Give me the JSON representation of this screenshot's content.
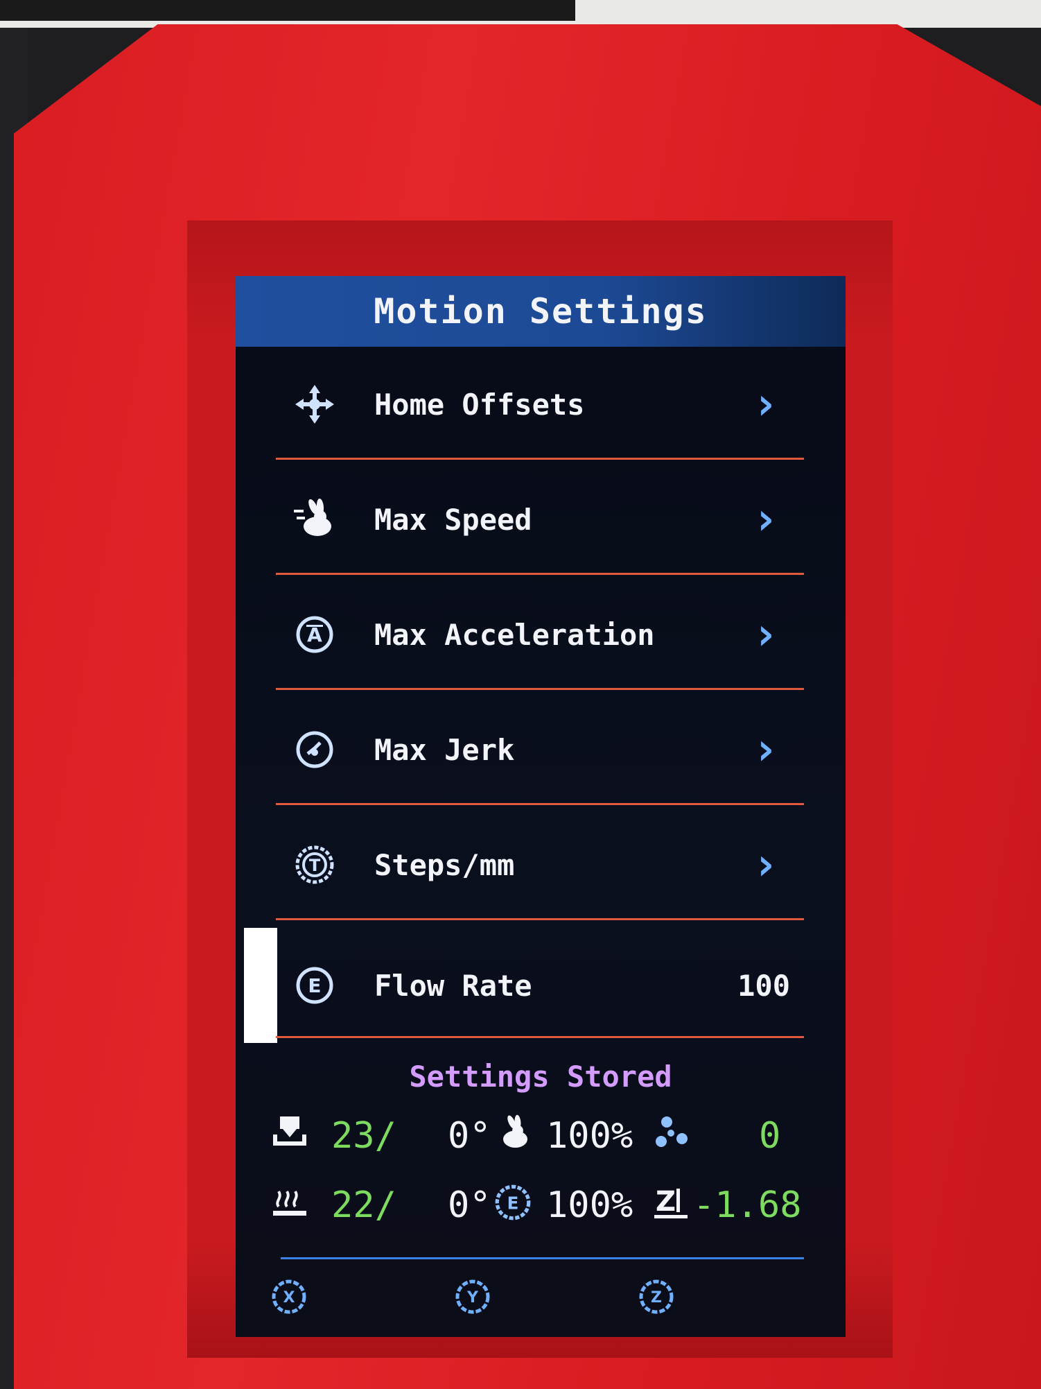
{
  "header": {
    "title": "Motion Settings"
  },
  "menu": [
    {
      "label": "Home Offsets",
      "icon": "move-arrows-icon",
      "has_submenu": true
    },
    {
      "label": "Max Speed",
      "icon": "rabbit-speed-icon",
      "has_submenu": true
    },
    {
      "label": "Max Acceleration",
      "icon": "acceleration-icon",
      "has_submenu": true
    },
    {
      "label": "Max Jerk",
      "icon": "jerk-gauge-icon",
      "has_submenu": true
    },
    {
      "label": "Steps/mm",
      "icon": "stepper-icon",
      "has_submenu": true
    },
    {
      "label": "Flow Rate",
      "icon": "extruder-e-icon",
      "value": "100",
      "selected": true
    }
  ],
  "status_message": "Settings Stored",
  "status": {
    "hotend_temp": "23",
    "hotend_target": "0°",
    "bed_temp": "22",
    "bed_target": "0°",
    "feedrate": "100%",
    "flowrate": "100%",
    "fan_speed": "0",
    "z_offset": "-1.68",
    "temp_unit_glyph": "/"
  },
  "axes": [
    "X",
    "Y",
    "Z"
  ],
  "colors": {
    "title_bar": "#1f4f9e",
    "separator": "#e0593c",
    "accent_blue": "#6fb0ff",
    "status_green": "#7ddc5f",
    "message_purple": "#d59cff",
    "case_red": "#e3262a"
  }
}
